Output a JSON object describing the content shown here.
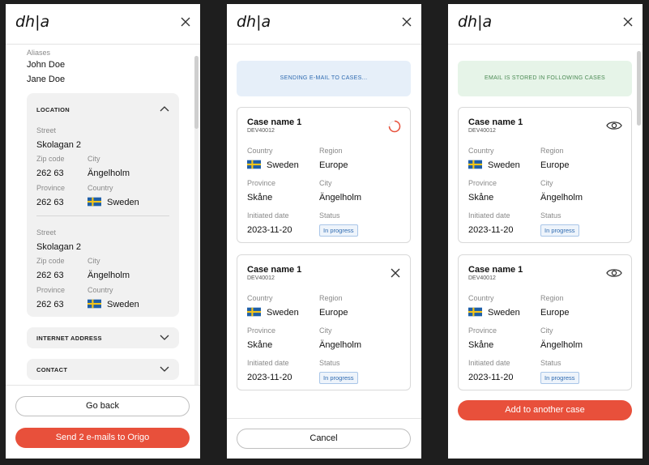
{
  "colors": {
    "accent_red": "#e8503b",
    "badge_blue": "#2f6bb1",
    "banner_blue_bg": "#e6eff9",
    "banner_green_bg": "#e6f4e8",
    "banner_green_text": "#4b8a54"
  },
  "app": {
    "logo": "dh|a"
  },
  "panel1": {
    "aliases_label": "Aliases",
    "aliases": [
      "John Doe",
      "Jane Doe"
    ],
    "location": {
      "title": "LOCATION",
      "addresses": [
        {
          "street_label": "Street",
          "street": "Skolagan 2",
          "zip_label": "Zip code",
          "zip": "262 63",
          "city_label": "City",
          "city": "Ängelholm",
          "province_label": "Province",
          "province": "262 63",
          "country_label": "Country",
          "country": "Sweden"
        },
        {
          "street_label": "Street",
          "street": "Skolagan 2",
          "zip_label": "Zip code",
          "zip": "262 63",
          "city_label": "City",
          "city": "Ängelholm",
          "province_label": "Province",
          "province": "262 63",
          "country_label": "Country",
          "country": "Sweden"
        }
      ]
    },
    "internet_title": "INTERNET ADDRESS",
    "contact_title": "CONTACT",
    "go_back": "Go back",
    "send": "Send 2 e-mails to Origo"
  },
  "panel2": {
    "banner": "SENDING E-MAIL TO CASES...",
    "cancel": "Cancel"
  },
  "panel3": {
    "banner": "EMAIL IS STORED IN FOLLOWING CASES",
    "add": "Add to another case"
  },
  "case": {
    "name": "Case name 1",
    "code": "DEV40012",
    "country_label": "Country",
    "country": "Sweden",
    "region_label": "Region",
    "region": "Europe",
    "province_label": "Province",
    "province": "Skåne",
    "city_label": "City",
    "city": "Ängelholm",
    "date_label": "Initiated date",
    "date": "2023-11-20",
    "status_label": "Status",
    "status": "In progress"
  }
}
